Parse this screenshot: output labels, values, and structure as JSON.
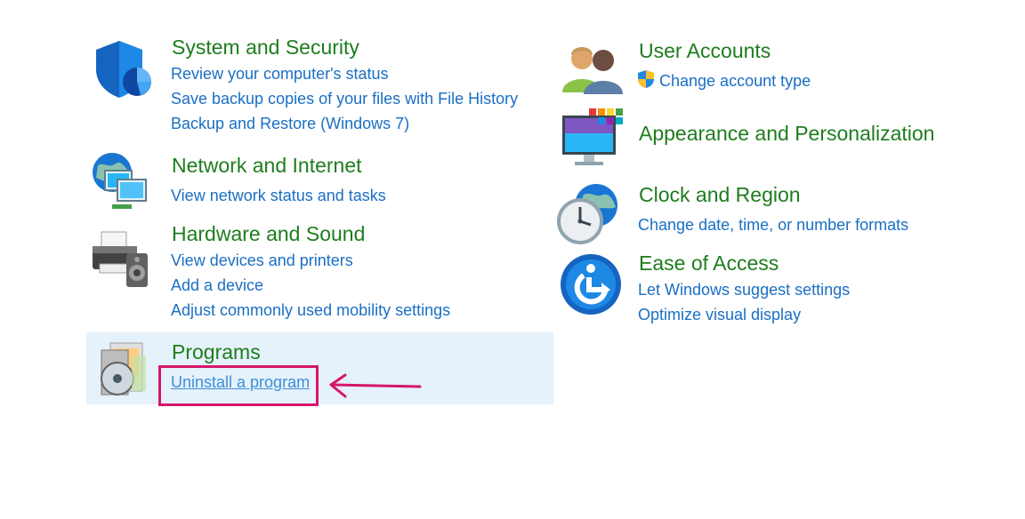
{
  "left": [
    {
      "key": "system",
      "title": "System and Security",
      "icon": "shield-icon",
      "links": [
        "Review your computer's status",
        "Save backup copies of your files with File History",
        "Backup and Restore (Windows 7)"
      ]
    },
    {
      "key": "network",
      "title": "Network and Internet",
      "icon": "network-globe-icon",
      "links": [
        "View network status and tasks"
      ]
    },
    {
      "key": "hardware",
      "title": "Hardware and Sound",
      "icon": "printer-speaker-icon",
      "links": [
        "View devices and printers",
        "Add a device",
        "Adjust commonly used mobility settings"
      ]
    },
    {
      "key": "programs",
      "title": "Programs",
      "icon": "programs-disc-icon",
      "links": [
        "Uninstall a program"
      ]
    }
  ],
  "right": [
    {
      "key": "users",
      "title": "User Accounts",
      "icon": "users-icon",
      "links": [
        "Change account type"
      ]
    },
    {
      "key": "appearance",
      "title": "Appearance and Personalization",
      "icon": "monitor-palette-icon",
      "links": []
    },
    {
      "key": "clock",
      "title": "Clock and Region",
      "icon": "clock-globe-icon",
      "links": [
        "Change date, time, or number formats"
      ]
    },
    {
      "key": "ease",
      "title": "Ease of Access",
      "icon": "ease-of-access-icon",
      "links": [
        "Let Windows suggest settings",
        "Optimize visual display"
      ]
    }
  ],
  "colors": {
    "title": "#1e7d1e",
    "link": "#1a6fc4",
    "hover_bg": "#e5f1fb",
    "annotation": "#d6166b"
  }
}
